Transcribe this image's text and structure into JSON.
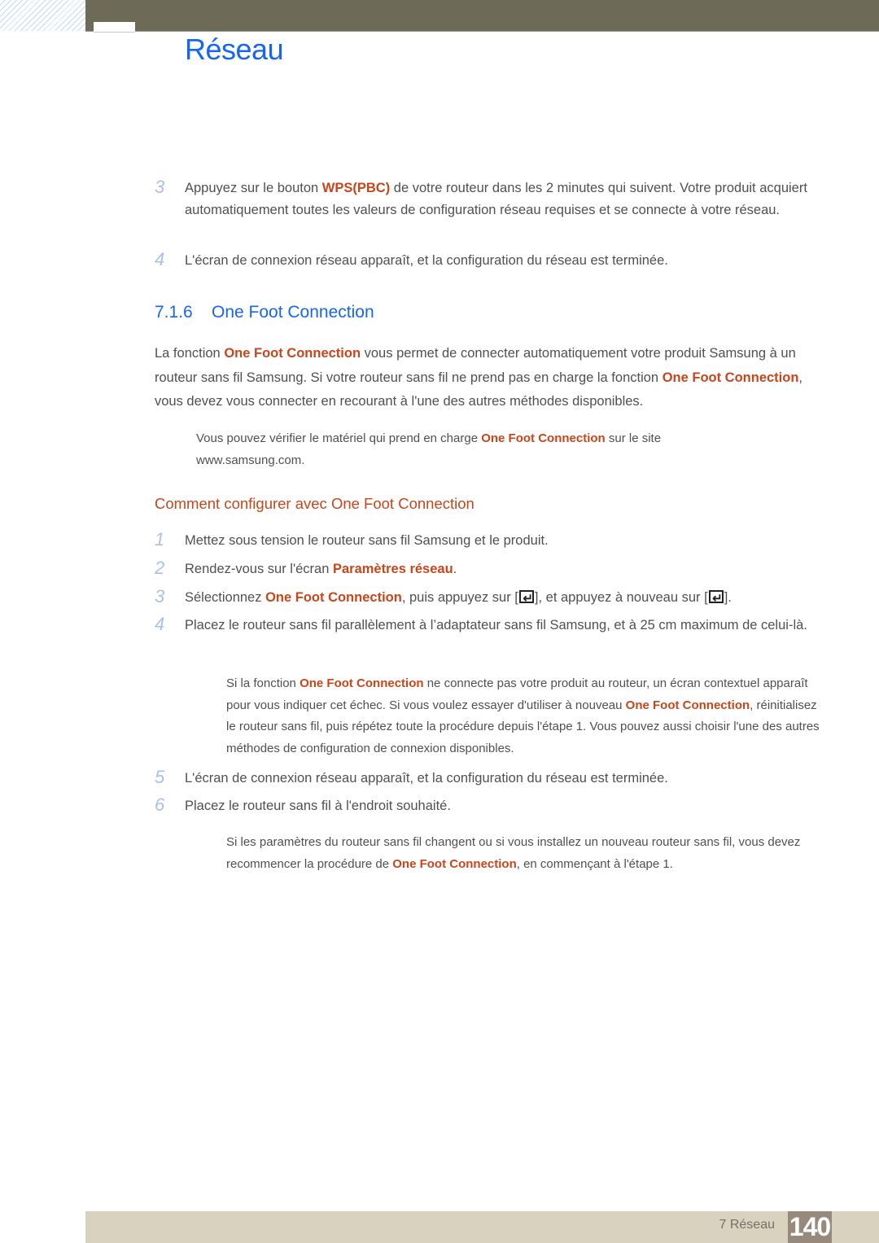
{
  "header": {
    "chapter_title": "Réseau"
  },
  "steps_top": [
    {
      "num": "3",
      "parts": [
        "Appuyez sur le bouton ",
        "WPS(PBC)",
        " de votre routeur dans les 2 minutes qui suivent. Votre produit acquiert automatiquement toutes les valeurs de configuration réseau requises et se connecte à votre réseau."
      ]
    },
    {
      "num": "4",
      "text": "L'écran de connexion réseau apparaît, et la configuration du réseau est terminée."
    }
  ],
  "section": {
    "number": "7.1.6",
    "title": "One Foot Connection"
  },
  "intro": {
    "p1": "La fonction ",
    "h1": "One Foot Connection",
    "p2": " vous permet de connecter automatiquement votre produit Samsung à un routeur sans fil Samsung. Si votre routeur sans fil ne prend pas en charge la fonction ",
    "h2": "One Foot Connection",
    "p3": ", vous devez vous connecter en recourant à l'une des autres méthodes disponibles."
  },
  "note1": {
    "p1": "Vous pouvez vérifier le matériel qui prend en charge ",
    "h1": "One Foot Connection",
    "p2": " sur le site www.samsung.com."
  },
  "subsection": {
    "title": "Comment configurer avec One Foot Connection"
  },
  "steps": [
    {
      "num": "1",
      "text": "Mettez sous tension le routeur sans fil Samsung et le produit."
    },
    {
      "num": "2",
      "p1": "Rendez-vous sur l'écran ",
      "h1": "Paramètres réseau",
      "p2": "."
    },
    {
      "num": "3",
      "p1": "Sélectionnez ",
      "h1": "One Foot Connection",
      "p2": ", puis appuyez sur [",
      "p3": "], et appuyez à nouveau sur [",
      "p4": "].",
      "icon": "enter-key-icon"
    },
    {
      "num": "4",
      "text": "Placez le routeur sans fil parallèlement à l’adaptateur sans fil Samsung, et à 25 cm maximum de celui-là."
    },
    {
      "num": "5",
      "text": "L'écran de connexion réseau apparaît, et la configuration du réseau est terminée."
    },
    {
      "num": "6",
      "text": "Placez le routeur sans fil à l'endroit souhaité."
    }
  ],
  "note2": {
    "p1": "Si la fonction ",
    "h1": "One Foot Connection",
    "p2": " ne connecte pas votre produit au routeur, un écran contextuel apparaît pour vous indiquer cet échec. Si vous voulez essayer d'utiliser à nouveau ",
    "h2": "One Foot Connection",
    "p3": ", réinitialisez le routeur sans fil, puis répétez toute la procédure depuis l'étape 1. Vous pouvez aussi choisir l'une des autres méthodes de configuration de connexion disponibles."
  },
  "note3": {
    "p1": "Si les paramètres du routeur sans fil changent ou si vous installez un nouveau routeur sans fil, vous devez recommencer la procédure de ",
    "h1": "One Foot Connection",
    "p2": ", en commençant à l'étape 1."
  },
  "footer": {
    "chapter_label": "7 Réseau",
    "page_number": "140"
  },
  "colors": {
    "title_blue": "#1765f0",
    "highlight_orange": "#c8461a",
    "step_number": "#a9c0ea",
    "top_bar": "#6d6b58",
    "footer_band": "#d8d2bf",
    "page_box": "#978a7d"
  }
}
